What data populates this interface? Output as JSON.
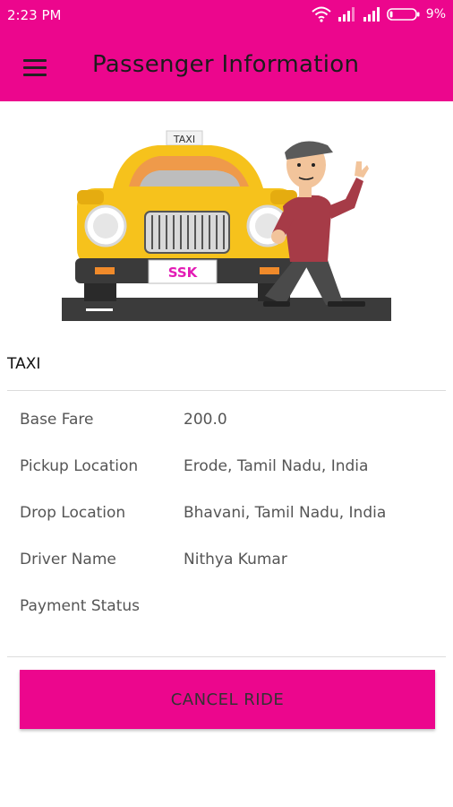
{
  "status_bar": {
    "time": "2:23 PM",
    "battery": "9%"
  },
  "header": {
    "title": "Passenger Information",
    "menu_icon": "hamburger-menu-icon"
  },
  "illustration": {
    "roof_sign": "TAXI",
    "plate": "SSK"
  },
  "vehicle_type": "TAXI",
  "details": [
    {
      "label": "Base Fare",
      "value": "200.0"
    },
    {
      "label": "Pickup Location",
      "value": "Erode, Tamil Nadu, India"
    },
    {
      "label": "Drop Location",
      "value": "Bhavani, Tamil Nadu, India"
    },
    {
      "label": "Driver Name",
      "value": "Nithya Kumar"
    },
    {
      "label": "Payment Status",
      "value": ""
    }
  ],
  "actions": {
    "cancel_label": "CANCEL RIDE"
  },
  "colors": {
    "primary": "#ec068d",
    "taxi_yellow": "#f6c21c"
  }
}
